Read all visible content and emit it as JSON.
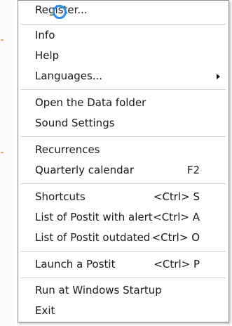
{
  "menu": {
    "items": [
      {
        "label": "Register..."
      },
      {
        "label": "Info"
      },
      {
        "label": "Help"
      },
      {
        "label": "Languages...",
        "submenu": true
      },
      {
        "label": "Open the Data folder"
      },
      {
        "label": "Sound Settings"
      },
      {
        "label": "Recurrences"
      },
      {
        "label": "Quarterly calendar",
        "shortcut": "F2"
      },
      {
        "label": "Shortcuts",
        "shortcut": "<Ctrl> S"
      },
      {
        "label": "List of Postit with alert",
        "shortcut": "<Ctrl> A"
      },
      {
        "label": "List of Postit outdated",
        "shortcut": "<Ctrl> O"
      },
      {
        "label": "Launch a Postit",
        "shortcut": "<Ctrl> P"
      },
      {
        "label": "Run at Windows Startup"
      },
      {
        "label": "Exit"
      }
    ]
  },
  "colors": {
    "cursor_ring": "#2a8df0",
    "separator": "#d0d0d0",
    "border": "#8e8e8e"
  },
  "icons": {
    "submenu": "chevron-right-icon",
    "cursor": "click-cursor-icon"
  }
}
